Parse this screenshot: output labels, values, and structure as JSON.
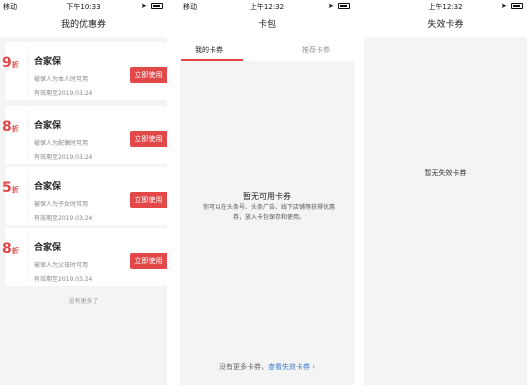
{
  "screen1": {
    "status": {
      "carrier": "移动",
      "time": "下午10:33"
    },
    "title": "我的优惠券",
    "coupons": [
      {
        "discount": "9",
        "unit": "折",
        "name": "合家保",
        "desc": "被保人为本人时可用",
        "expiry": "有效期至2019.03.24",
        "button": "立即使用"
      },
      {
        "discount": "8",
        "unit": "折",
        "name": "合家保",
        "desc": "被保人为配偶时可用",
        "expiry": "有效期至2019.03.24",
        "button": "立即使用"
      },
      {
        "discount": "5",
        "unit": "折",
        "name": "合家保",
        "desc": "被保人为子女时可用",
        "expiry": "有效期至2019.03.24",
        "button": "立即使用"
      },
      {
        "discount": "8",
        "unit": "折",
        "name": "合家保",
        "desc": "被保人为父母时可用",
        "expiry": "有效期至2019.03.24",
        "button": "立即使用"
      }
    ],
    "no_more": "没有更多了"
  },
  "screen2": {
    "status": {
      "carrier": "移动",
      "time": "上午12:32"
    },
    "title": "卡包",
    "tabs": {
      "mine": "我的卡券",
      "recommended": "推荐卡券"
    },
    "empty_title": "暂无可用卡券",
    "empty_desc": "你可以在头条号、头条广告、线下店铺等获得优惠券，放入卡包保存和使用。",
    "footer_text": "没有更多卡券，",
    "footer_link": "查看失效卡券 ›"
  },
  "screen3": {
    "status": {
      "carrier": "",
      "time": "上午12:32"
    },
    "title": "失效卡券",
    "empty_text": "暂无失效卡券"
  },
  "colors": {
    "accent": "#e24848",
    "link": "#3a7bd5",
    "background": "#f4f4f4"
  }
}
